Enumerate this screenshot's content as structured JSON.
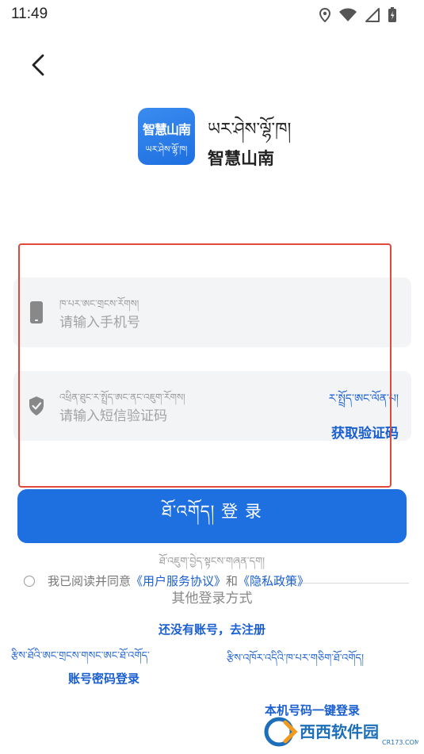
{
  "status_bar": {
    "time": "11:49"
  },
  "app": {
    "logo_text": "智慧山南",
    "logo_tibetan": "ཡར་ཤེས་ལྷོ་ཁ།",
    "name_tibetan": "ཡར་ཤེས་ལྷོ་ཁ།",
    "name_chinese": "智慧山南",
    "brand_color": "#1e6fe0"
  },
  "form": {
    "phone": {
      "tibetan_placeholder": "ཁ་པར་ཨང་གྲངས་རོགས།",
      "placeholder": "请输入手机号",
      "value": ""
    },
    "code": {
      "tibetan_placeholder": "འཕྲིན་ཐུང་ར་སྤྲོད་ཨང་ནང་འཇུག་རོགས།",
      "placeholder": "请输入短信验证码",
      "value": "",
      "get_code_tibetan": "ར་སྤྲོད་ཨང་ལོན་པ།",
      "get_code_label": "获取验证码"
    },
    "login_button": "ཐོ་འགོད། 登 录"
  },
  "other_login_tibetan": "ཐོ་འཇུག་བྱེད་སྟངས་གཞན་དག།",
  "agreement": {
    "prefix": "我已阅读并同意",
    "user_agreement": "《用户服务协议》",
    "and": "和",
    "privacy_policy": "《隐私政策》"
  },
  "other_login_label": "其他登录方式",
  "register_label": "还没有账号，去注册",
  "alt_logins": {
    "password_tibetan": "རྩིས་ཐོའི་ཨང་གྲངས་གསང་ཨང་ཐོ་འགོད་",
    "password_label": "账号密码登录",
    "onekey_tibetan": "རྩིས་འཁོར་འདིའི་ཁ་པར་གཅིག་ཐོ་འགོད།",
    "onekey_label": "本机号码一键登录"
  },
  "watermark": {
    "brand": "西西软件园",
    "site": "CR173.COM"
  },
  "colors": {
    "link": "#1a5fd0",
    "field_background": "#f3f4f6",
    "highlight_border": "#e04a3a"
  }
}
